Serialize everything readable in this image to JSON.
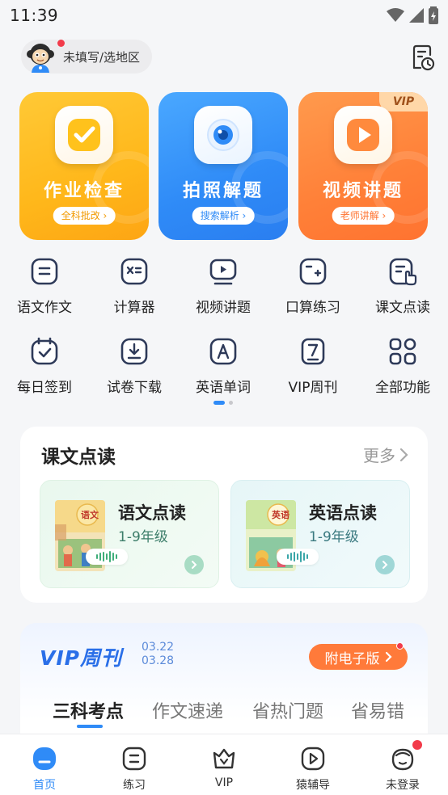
{
  "status_bar": {
    "time": "11:39"
  },
  "header": {
    "region_text": "未填写/选地区"
  },
  "main_tiles": [
    {
      "title": "作业检查",
      "subtitle": "全科批改 ›"
    },
    {
      "title": "拍照解题",
      "subtitle": "搜索解析 ›"
    },
    {
      "title": "视频讲题",
      "subtitle": "老师讲解 ›",
      "badge": "VIP"
    }
  ],
  "tools": [
    {
      "label": "语文作文",
      "icon": "essay-icon"
    },
    {
      "label": "计算器",
      "icon": "calculator-icon"
    },
    {
      "label": "视频讲题",
      "icon": "video-lesson-icon"
    },
    {
      "label": "口算练习",
      "icon": "mental-math-icon"
    },
    {
      "label": "课文点读",
      "icon": "text-reading-icon"
    },
    {
      "label": "每日签到",
      "icon": "daily-checkin-icon"
    },
    {
      "label": "试卷下载",
      "icon": "paper-download-icon"
    },
    {
      "label": "英语单词",
      "icon": "english-words-icon"
    },
    {
      "label": "VIP周刊",
      "icon": "vip-weekly-icon"
    },
    {
      "label": "全部功能",
      "icon": "all-functions-icon"
    }
  ],
  "reading": {
    "title": "课文点读",
    "more": "更多",
    "items": [
      {
        "name": "语文点读",
        "grade": "1-9年级",
        "book_text": "语文"
      },
      {
        "name": "英语点读",
        "grade": "1-9年级",
        "book_text": "英语"
      }
    ]
  },
  "vip_weekly": {
    "logo": "VIP周刊",
    "date_start": "03.22",
    "date_end": "03.28",
    "ebook_button": "附电子版",
    "tabs": [
      "三科考点",
      "作文速递",
      "省热门题",
      "省易错"
    ]
  },
  "bottom_nav": [
    {
      "label": "首页",
      "active": true
    },
    {
      "label": "练习"
    },
    {
      "label": "VIP"
    },
    {
      "label": "猿辅导"
    },
    {
      "label": "未登录"
    }
  ],
  "colors": {
    "accent": "#2f8bf7",
    "orange": "#ff7a3a",
    "yellow": "#ffb71a",
    "badge_red": "#f23b4a"
  }
}
